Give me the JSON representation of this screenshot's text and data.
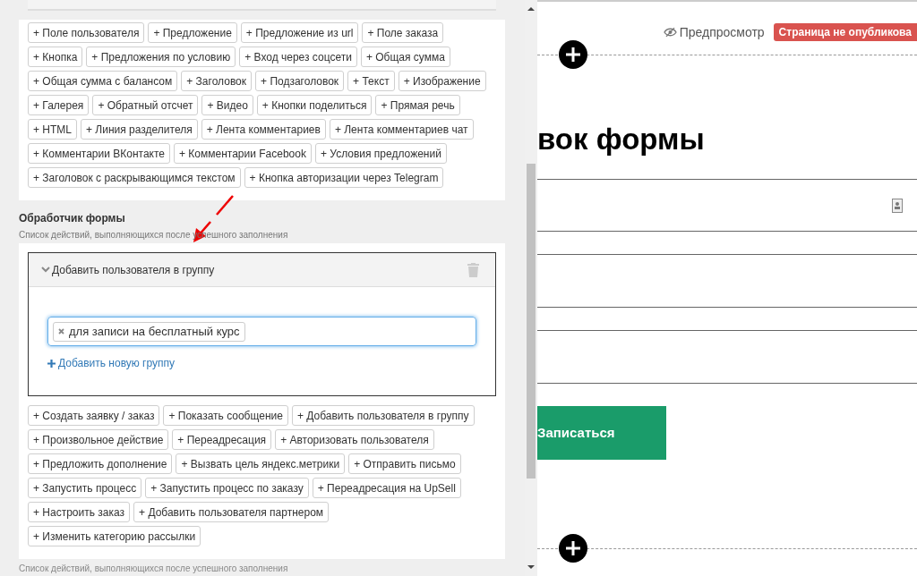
{
  "blocks_panel": {
    "chips": [
      "+ Поле пользователя",
      "+ Предложение",
      "+ Предложение из url",
      "+ Поле заказа",
      "+ Кнопка",
      "+ Предложения по условию",
      "+ Вход через соцсети",
      "+ Общая сумма",
      "+ Общая сумма с балансом",
      "+ Заголовок",
      "+ Подзаголовок",
      "+ Текст",
      "+ Изображение",
      "+ Галерея",
      "+ Обратный отсчет",
      "+ Видео",
      "+ Кнопки поделиться",
      "+ Прямая речь",
      "+ HTML",
      "+ Линия разделителя",
      "+ Лента комментариев",
      "+ Лента комментариев чат",
      "+ Комментарии ВКонтакте",
      "+ Комментарии Facebook",
      "+ Условия предложений",
      "+ Заголовок с раскрывающимся текстом",
      "+ Кнопка авторизации через Telegram"
    ]
  },
  "form_handler": {
    "title": "Обработчик формы",
    "subtitle": "Список действий, выполняющихся после успешного заполнения",
    "action": {
      "title": "Добавить пользователя в группу",
      "expanded": true,
      "tags": [
        "для записи на бесплатный курс"
      ],
      "add_link": "Добавить новую группу"
    },
    "chips": [
      "+ Создать заявку / заказ",
      "+ Показать сообщение",
      "+ Добавить пользователя в группу",
      "+ Произвольное действие",
      "+ Переадресация",
      "+ Авторизовать пользователя",
      "+ Предложить дополнение",
      "+ Вызвать цель яндекс.метрики",
      "+ Отправить письмо",
      "+ Запустить процесс",
      "+ Запустить процесс по заказу",
      "+ Переадресация на UpSell",
      "+ Настроить заказ",
      "+ Добавить пользователя партнером",
      "+ Изменить категорию рассылки"
    ],
    "footer": "Список действий, выполняющихся после успешного заполнения"
  },
  "preview": {
    "preview_link": "Предпросмотр",
    "status_badge": "Страница не опубликова",
    "heading": "вок формы",
    "submit_button": "Записаться"
  }
}
